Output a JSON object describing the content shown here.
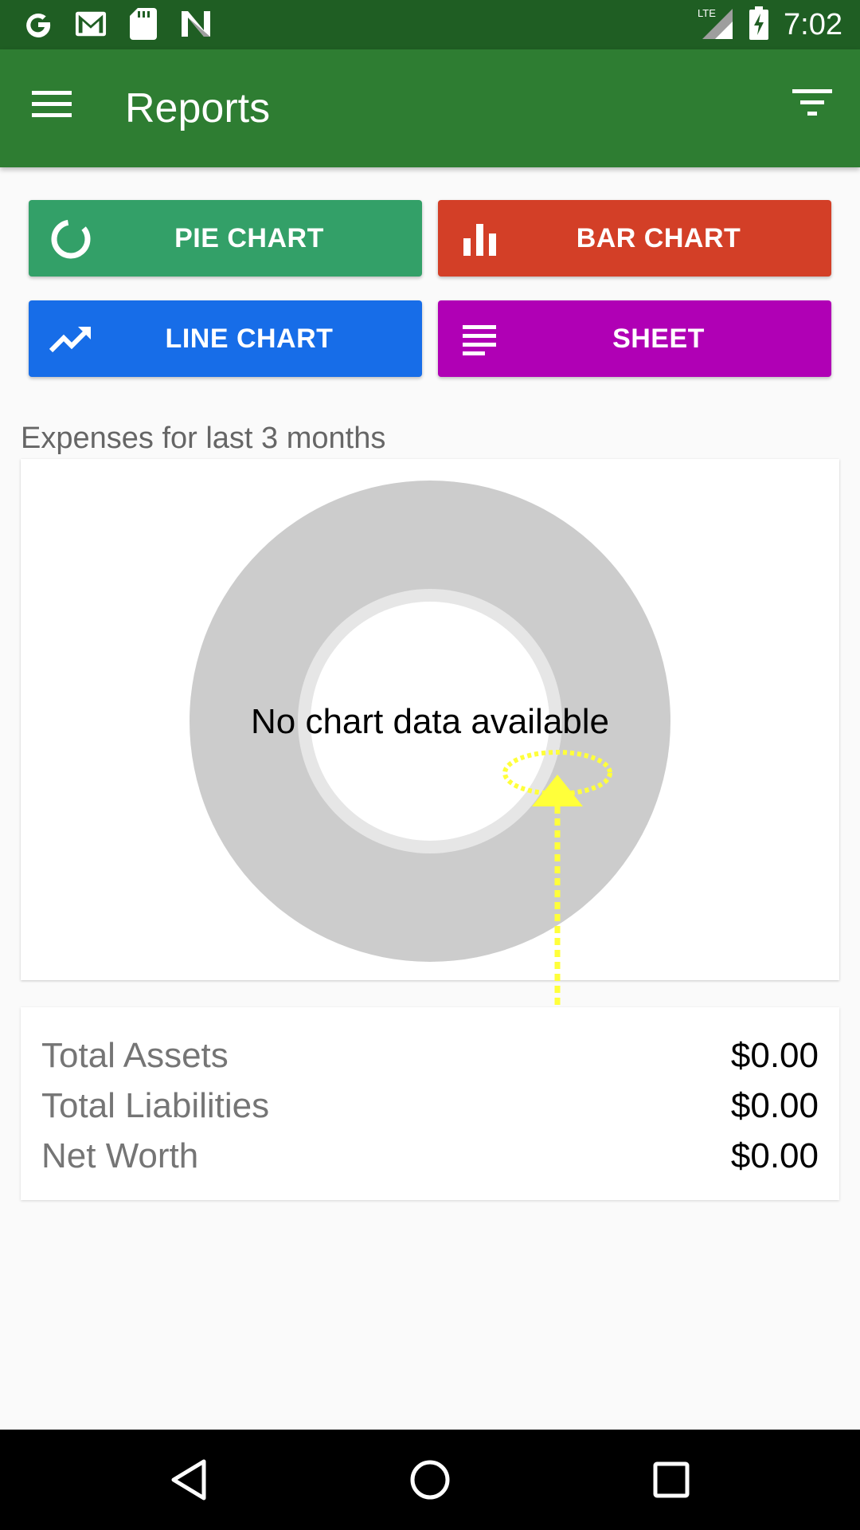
{
  "status_bar": {
    "time": "7:02",
    "network": "LTE",
    "left_icons": [
      "google-icon",
      "gmail-icon",
      "sd-card-icon",
      "n-icon"
    ]
  },
  "app_bar": {
    "title": "Reports",
    "menu_icon": "menu-icon",
    "filter_icon": "filter-icon",
    "color": "#2e7d32"
  },
  "buttons": [
    {
      "label": "PIE CHART",
      "icon": "pie-chart-icon",
      "color": "#33a068"
    },
    {
      "label": "BAR CHART",
      "icon": "bar-chart-icon",
      "color": "#d33f27"
    },
    {
      "label": "LINE CHART",
      "icon": "line-chart-icon",
      "color": "#176de8"
    },
    {
      "label": "SHEET",
      "icon": "sheet-icon",
      "color": "#b000b5"
    }
  ],
  "chart_section": {
    "title": "Expenses for last 3 months",
    "empty_message": "No chart data available"
  },
  "totals": [
    {
      "label": "Total Assets",
      "value": "$0.00"
    },
    {
      "label": "Total Liabilities",
      "value": "$0.00"
    },
    {
      "label": "Net Worth",
      "value": "$0.00"
    }
  ],
  "nav_bar": {
    "icons": [
      "back-icon",
      "home-icon",
      "recents-icon"
    ]
  }
}
